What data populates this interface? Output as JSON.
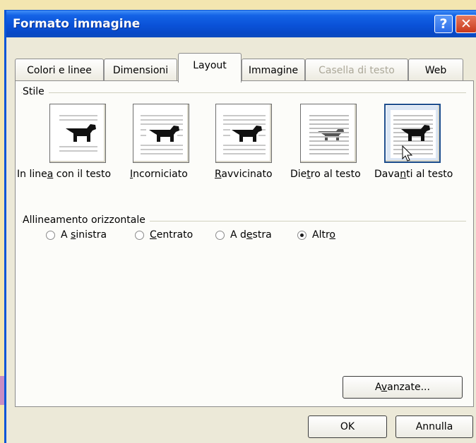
{
  "window": {
    "title": "Formato immagine",
    "help_glyph": "?",
    "close_glyph": "✕"
  },
  "tabs": [
    {
      "label": "Colori e linee",
      "state": "normal"
    },
    {
      "label": "Dimensioni",
      "state": "normal"
    },
    {
      "label": "Layout",
      "state": "active"
    },
    {
      "label": "Immagine",
      "state": "normal"
    },
    {
      "label": "Casella di testo",
      "state": "disabled"
    },
    {
      "label": "Web",
      "state": "normal"
    }
  ],
  "style_group": {
    "label": "Stile",
    "options": [
      {
        "pre": "In line",
        "u": "a",
        "post": " con il testo",
        "icon": "wrap-inline-icon"
      },
      {
        "pre": "",
        "u": "I",
        "post": "ncorniciato",
        "icon": "wrap-square-icon"
      },
      {
        "pre": "",
        "u": "R",
        "post": "avvicinato",
        "icon": "wrap-tight-icon"
      },
      {
        "pre": "Die",
        "u": "t",
        "post": "ro al testo",
        "icon": "wrap-behind-text-icon"
      },
      {
        "pre": "Dava",
        "u": "n",
        "post": "ti al testo",
        "icon": "wrap-in-front-of-text-icon"
      }
    ],
    "selected": "Davanti al testo"
  },
  "alignment_group": {
    "label": "Allineamento orizzontale",
    "options": [
      {
        "pre": "A ",
        "u": "s",
        "post": "inistra",
        "checked": false
      },
      {
        "pre": "",
        "u": "C",
        "post": "entrato",
        "checked": false
      },
      {
        "pre": "A d",
        "u": "e",
        "post": "stra",
        "checked": false
      },
      {
        "pre": "Altr",
        "u": "o",
        "post": "",
        "checked": true
      }
    ]
  },
  "buttons": {
    "advanced": {
      "pre": "A",
      "u": "v",
      "post": "anzate..."
    },
    "ok": "OK",
    "cancel": "Annulla"
  },
  "colors": {
    "titlebar": "#0a52d8",
    "dialog": "#ece9d8",
    "panel": "#fcfcf9",
    "arrow": "#c98dc3",
    "background": "#f3e6b0"
  },
  "icons": [
    "help-icon",
    "close-icon",
    "dog-picture-icon",
    "mouse-cursor-icon",
    "callout-arrow"
  ]
}
